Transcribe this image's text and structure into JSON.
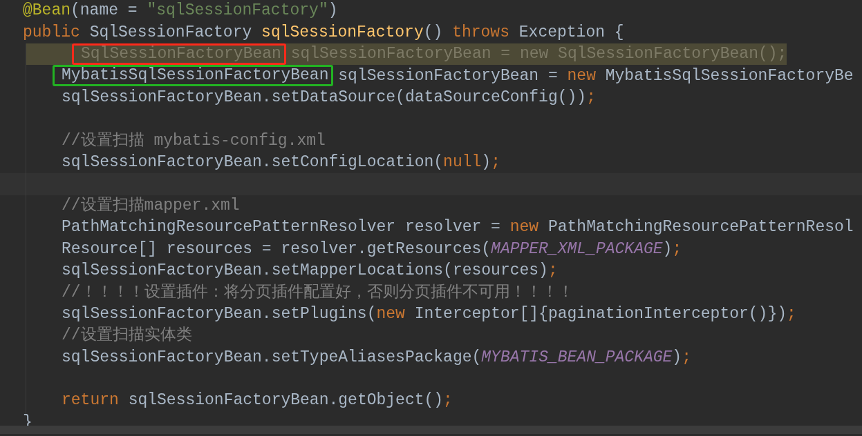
{
  "editor": {
    "lines": [
      {
        "kind": "code",
        "tokens": [
          {
            "kind": "annotation",
            "text": "@Bean"
          },
          {
            "kind": "plain",
            "text": "(name = "
          },
          {
            "kind": "string",
            "text": "\"sqlSessionFactory\""
          },
          {
            "kind": "plain",
            "text": ")"
          }
        ]
      },
      {
        "kind": "code",
        "tokens": [
          {
            "kind": "keyword",
            "text": "public"
          },
          {
            "kind": "plain",
            "text": " SqlSessionFactory "
          },
          {
            "kind": "method",
            "text": "sqlSessionFactory"
          },
          {
            "kind": "plain",
            "text": "() "
          },
          {
            "kind": "keyword",
            "text": "throws"
          },
          {
            "kind": "plain",
            "text": " Exception {"
          }
        ],
        "children": [
          {
            "kind": "ghost",
            "tokens": [
              {
                "text": "SqlSessionFactoryBean",
                "color": "#ff2a1a"
              },
              {
                "text": " sqlSessionFactoryBean = new SqlSessionFactoryBean();"
              }
            ]
          },
          {
            "kind": "code",
            "tokens": [
              {
                "kind": "plain",
                "text": "MybatisSqlSessionFactoryBean",
                "color": "#22b322"
              },
              {
                "kind": "plain",
                "text": " sqlSessionFactoryBean = "
              },
              {
                "kind": "keyword",
                "text": "new"
              },
              {
                "kind": "plain",
                "text": " MybatisSqlSessionFactoryBe"
              }
            ]
          },
          {
            "kind": "code",
            "tokens": [
              {
                "kind": "plain",
                "text": "sqlSessionFactoryBean.setDataSource(dataSourceConfig())"
              },
              {
                "kind": "keyword",
                "text": ";"
              }
            ]
          },
          {
            "kind": "blank"
          },
          {
            "kind": "code",
            "tokens": [
              {
                "kind": "comment",
                "text": "//设置扫描 mybatis-config.xml"
              }
            ]
          },
          {
            "kind": "code",
            "tokens": [
              {
                "kind": "plain",
                "text": "sqlSessionFactoryBean.setConfigLocation("
              },
              {
                "kind": "keyword",
                "text": "null"
              },
              {
                "kind": "plain",
                "text": ")"
              },
              {
                "kind": "keyword",
                "text": ";"
              }
            ]
          },
          {
            "kind": "current"
          },
          {
            "kind": "code",
            "tokens": [
              {
                "kind": "comment",
                "text": "//设置扫描mapper.xml"
              }
            ]
          },
          {
            "kind": "code",
            "tokens": [
              {
                "kind": "plain",
                "text": "PathMatchingResourcePatternResolver resolver = "
              },
              {
                "kind": "keyword",
                "text": "new"
              },
              {
                "kind": "plain",
                "text": " PathMatchingResourcePatternResol"
              }
            ]
          },
          {
            "kind": "code",
            "tokens": [
              {
                "kind": "plain",
                "text": "Resource[] resources = resolver.getResources("
              },
              {
                "kind": "constant",
                "text": "MAPPER_XML_PACKAGE"
              },
              {
                "kind": "plain",
                "text": ")"
              },
              {
                "kind": "keyword",
                "text": ";"
              }
            ]
          },
          {
            "kind": "code",
            "tokens": [
              {
                "kind": "plain",
                "text": "sqlSessionFactoryBean.setMapperLocations(resources)"
              },
              {
                "kind": "keyword",
                "text": ";"
              }
            ]
          },
          {
            "kind": "code",
            "tokens": [
              {
                "kind": "comment",
                "text": "//！！！！设置插件：将分页插件配置好，否则分页插件不可用！！！！"
              }
            ]
          },
          {
            "kind": "code",
            "tokens": [
              {
                "kind": "plain",
                "text": "sqlSessionFactoryBean.setPlugins("
              },
              {
                "kind": "keyword",
                "text": "new"
              },
              {
                "kind": "plain",
                "text": " Interceptor[]{paginationInterceptor()})"
              },
              {
                "kind": "keyword",
                "text": ";"
              }
            ]
          },
          {
            "kind": "code",
            "tokens": [
              {
                "kind": "comment",
                "text": "//设置扫描实体类"
              }
            ]
          },
          {
            "kind": "code",
            "tokens": [
              {
                "kind": "plain",
                "text": "sqlSessionFactoryBean.setTypeAliasesPackage("
              },
              {
                "kind": "constant",
                "text": "MYBATIS_BEAN_PACKAGE"
              },
              {
                "kind": "plain",
                "text": ")"
              },
              {
                "kind": "keyword",
                "text": ";"
              }
            ]
          },
          {
            "kind": "blank"
          },
          {
            "kind": "code",
            "tokens": [
              {
                "kind": "keyword",
                "text": "return"
              },
              {
                "kind": "plain",
                "text": " sqlSessionFactoryBean.getObject()"
              },
              {
                "kind": "keyword",
                "text": ";"
              }
            ]
          }
        ]
      },
      {
        "kind": "code",
        "tokens": [
          {
            "kind": "plain",
            "text": "}"
          }
        ]
      }
    ]
  }
}
